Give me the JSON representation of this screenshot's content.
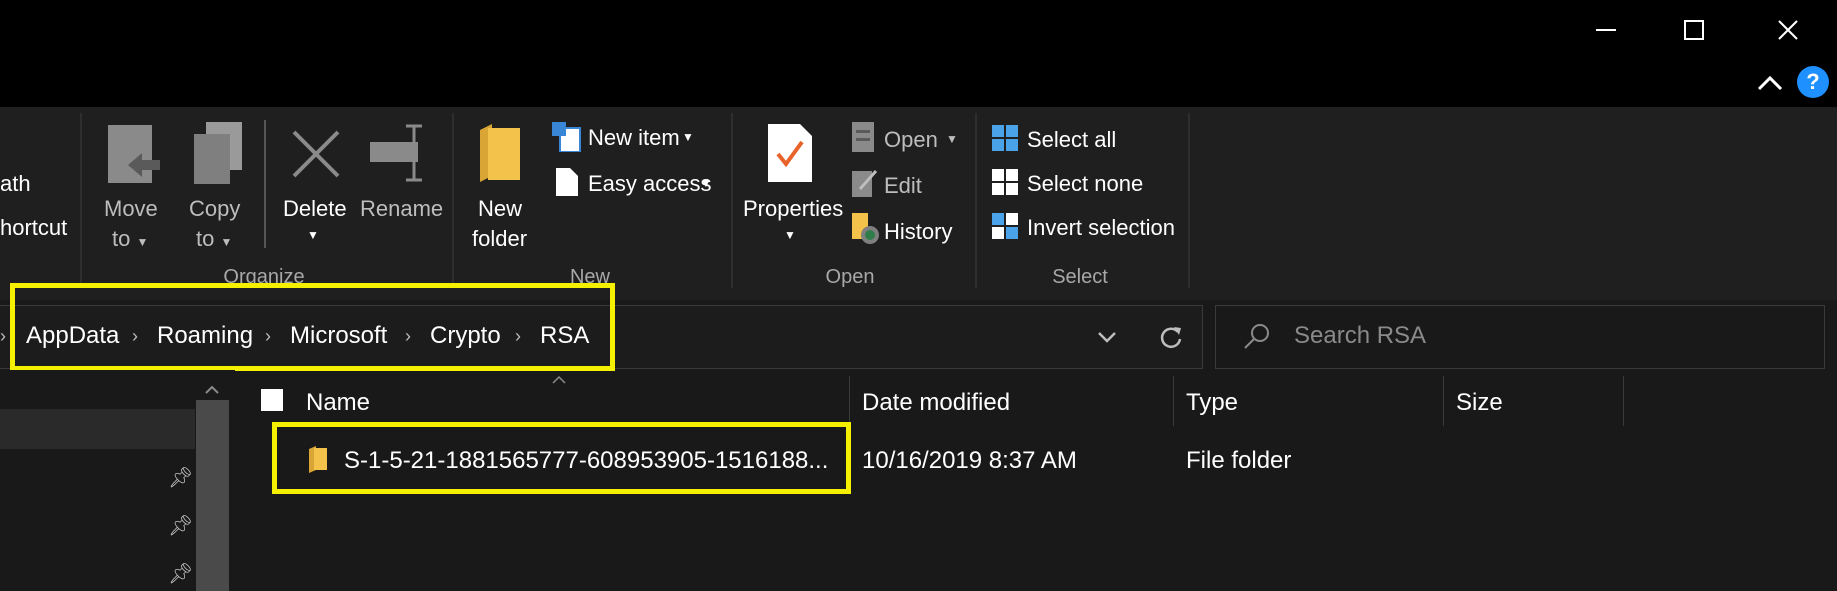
{
  "window": {
    "minimize_icon": "minimize-icon",
    "maximize_icon": "maximize-icon",
    "close_icon": "close-icon",
    "collapse_ribbon_icon": "chevron-up-icon",
    "help_label": "?"
  },
  "ribbon": {
    "clipboard_partial": [
      "ath",
      "hortcut"
    ],
    "organize": {
      "label": "Organize",
      "move_to": [
        "Move",
        "to"
      ],
      "copy_to": [
        "Copy",
        "to"
      ],
      "delete": "Delete",
      "rename": "Rename"
    },
    "new": {
      "label": "New",
      "new_folder": [
        "New",
        "folder"
      ],
      "new_item": "New item",
      "easy_access": "Easy access"
    },
    "open": {
      "label": "Open",
      "properties": "Properties",
      "open": "Open",
      "edit": "Edit",
      "history": "History"
    },
    "select": {
      "label": "Select",
      "select_all": "Select all",
      "select_none": "Select none",
      "invert_selection": "Invert selection"
    }
  },
  "address": {
    "breadcrumbs": [
      "AppData",
      "Roaming",
      "Microsoft",
      "Crypto",
      "RSA"
    ],
    "search_placeholder": "Search RSA"
  },
  "columns": {
    "name": "Name",
    "date_modified": "Date modified",
    "type": "Type",
    "size": "Size"
  },
  "files": [
    {
      "name": "S-1-5-21-1881565777-608953905-1516188...",
      "date_modified": "10/16/2019 8:37 AM",
      "type": "File folder",
      "size": ""
    }
  ],
  "colors": {
    "highlight": "#f4f000",
    "accent": "#1e90ff",
    "folder": "#f2c24a"
  }
}
